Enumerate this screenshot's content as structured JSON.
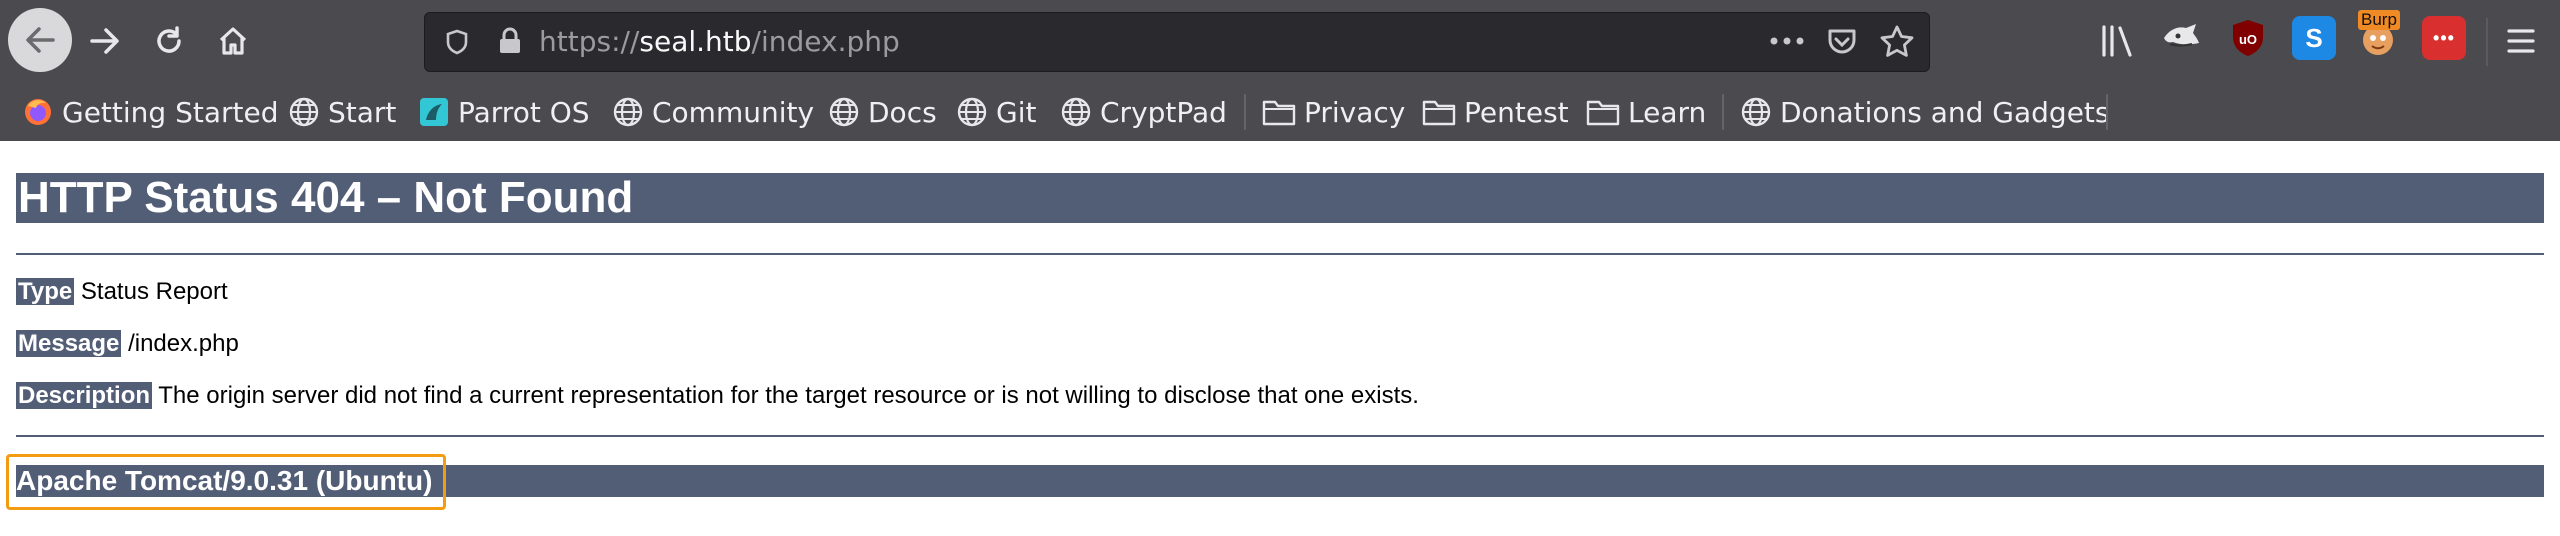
{
  "browser": {
    "url": {
      "protocol": "https://",
      "host": "seal.htb",
      "path": "/index.php"
    },
    "extensions": {
      "burp_label": "Burp"
    },
    "bookmarks": [
      {
        "label": "Getting Started",
        "icon": "firefox-icon"
      },
      {
        "label": "Start",
        "icon": "globe-icon"
      },
      {
        "label": "Parrot OS",
        "icon": "parrot-icon"
      },
      {
        "label": "Community",
        "icon": "globe-icon"
      },
      {
        "label": "Docs",
        "icon": "globe-icon"
      },
      {
        "label": "Git",
        "icon": "globe-icon"
      },
      {
        "label": "CryptPad",
        "icon": "globe-icon"
      },
      {
        "label": "Privacy",
        "icon": "folder-icon"
      },
      {
        "label": "Pentest",
        "icon": "folder-icon"
      },
      {
        "label": "Learn",
        "icon": "folder-icon"
      },
      {
        "label": "Donations and Gadgets",
        "icon": "globe-icon"
      }
    ]
  },
  "page": {
    "title": "HTTP Status 404 – Not Found",
    "type_label": "Type",
    "type_value": "Status Report",
    "message_label": "Message",
    "message_value": "/index.php",
    "description_label": "Description",
    "description_value": "The origin server did not find a current representation for the target resource or is not willing to disclose that one exists.",
    "server": "Apache Tomcat/9.0.31 (Ubuntu)"
  },
  "colors": {
    "chrome": "#4a4a4f",
    "urlbar": "#2a2a2e",
    "heading_bg": "#525d76",
    "highlight": "#f39c12"
  }
}
